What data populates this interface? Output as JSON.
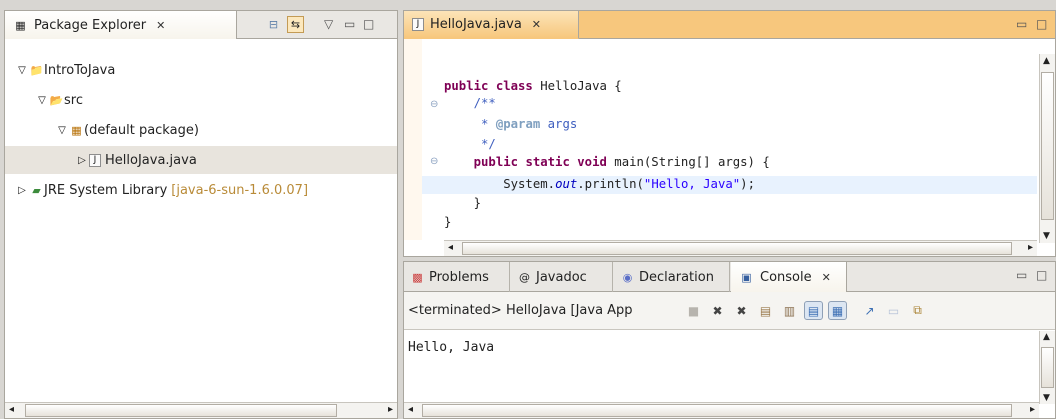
{
  "colors": {
    "editor_tab_active": "#f7c77d",
    "selection": "#e8e4dd",
    "current_line": "#e8f2fe",
    "keyword": "#7f0055",
    "string": "#2a00ff",
    "comment": "#3f5fbf"
  },
  "package_explorer": {
    "title": "Package Explorer",
    "close_glyph": "✕",
    "toolbar_icons": [
      "collapse-all-icon",
      "link-with-editor-icon",
      "view-menu-icon",
      "minimize-icon",
      "maximize-icon"
    ],
    "tree": [
      {
        "label": "IntroToJava",
        "icon": "project-icon",
        "expanded": true
      },
      {
        "label": "src",
        "icon": "source-folder-icon",
        "expanded": true
      },
      {
        "label": "(default package)",
        "icon": "package-icon",
        "expanded": true
      },
      {
        "label": "HelloJava.java",
        "icon": "java-file-icon",
        "expanded": false,
        "selected": true
      },
      {
        "label": "JRE System Library",
        "suffix": "[java-6-sun-1.6.0.07]",
        "icon": "library-icon",
        "expanded": false
      }
    ]
  },
  "editor": {
    "tab_label": "HelloJava.java",
    "close_glyph": "✕",
    "lines": [
      "public class HelloJava {",
      "    /**",
      "     * @param args",
      "     */",
      "    public static void main(String[] args) {",
      "        System.out.println(\"Hello, Java\");",
      "    }",
      "}"
    ]
  },
  "bottom_tabs": [
    {
      "label": "Problems",
      "icon": "problems-icon"
    },
    {
      "label": "Javadoc",
      "icon": "at-icon"
    },
    {
      "label": "Declaration",
      "icon": "declaration-icon"
    },
    {
      "label": "Console",
      "icon": "console-icon",
      "active": true
    }
  ],
  "console": {
    "status": "<terminated> HelloJava [Java App",
    "output": "Hello, Java",
    "toolbar_icons": [
      "terminate-icon",
      "remove-launch-icon",
      "remove-all-icon",
      "clear-console-icon",
      "scroll-lock-icon",
      "show-output-icon",
      "pin-console-icon",
      "open-console-icon",
      "display-console-icon",
      "new-console-icon"
    ]
  }
}
